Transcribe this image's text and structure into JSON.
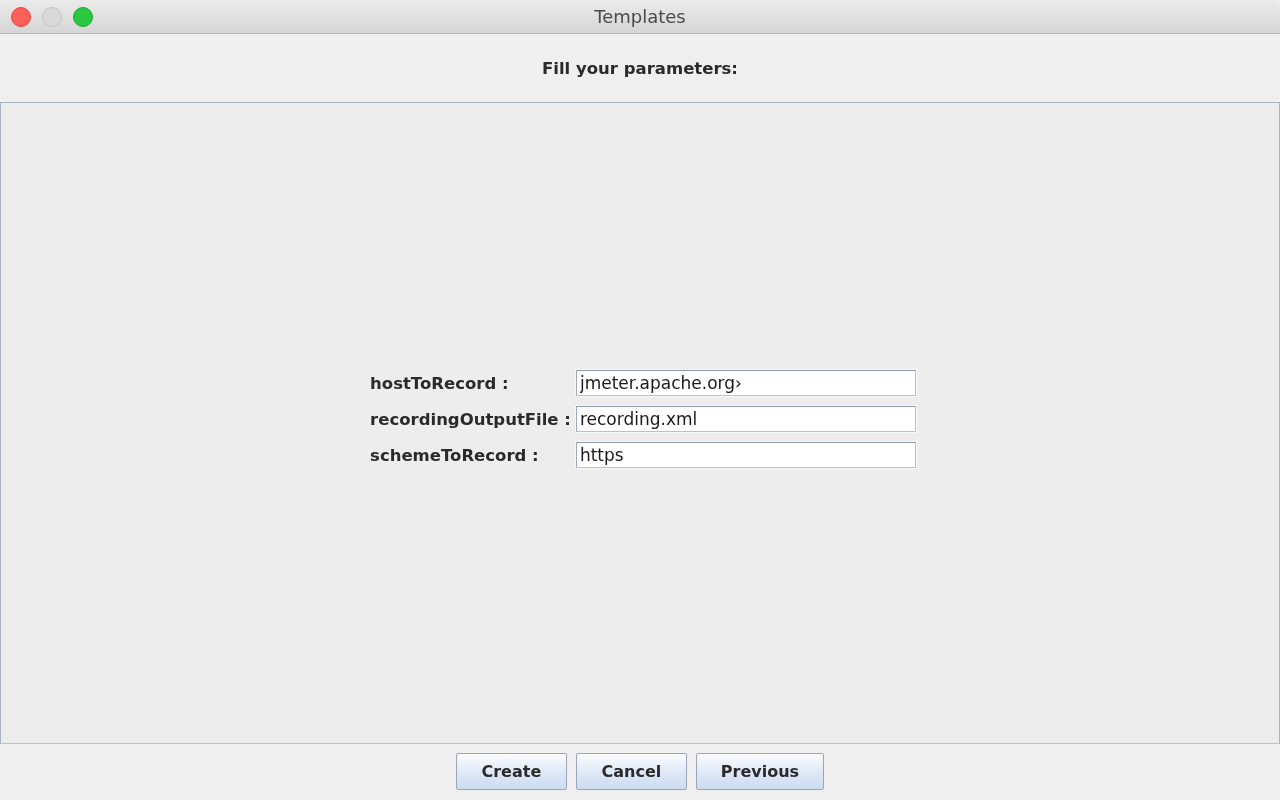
{
  "window": {
    "title": "Templates",
    "controls": [
      {
        "kind": "close",
        "disabled": false
      },
      {
        "kind": "minimize",
        "disabled": true
      },
      {
        "kind": "zoom",
        "disabled": false
      }
    ]
  },
  "heading": "Fill your parameters:",
  "parameters": [
    {
      "label": "hostToRecord :",
      "value": "jmeter.apache.org›"
    },
    {
      "label": "recordingOutputFile :",
      "value": "recording.xml"
    },
    {
      "label": "schemeToRecord :",
      "value": "https"
    }
  ],
  "buttons": [
    {
      "label": "Create"
    },
    {
      "label": "Cancel"
    },
    {
      "label": "Previous"
    }
  ]
}
